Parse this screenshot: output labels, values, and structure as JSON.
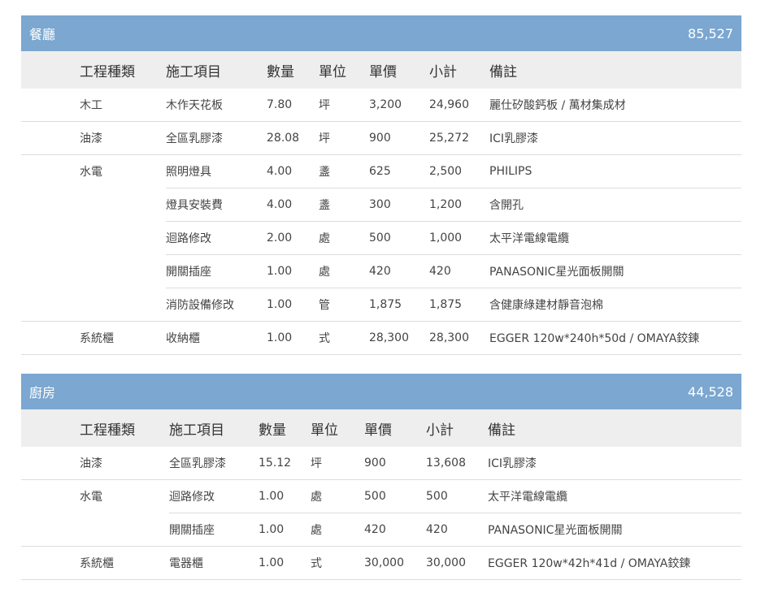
{
  "sections": [
    {
      "name": "餐廳",
      "total": "85,527",
      "headers": [
        "工程種類",
        "施工項目",
        "數量",
        "單位",
        "單價",
        "小計",
        "備註"
      ],
      "rows": [
        {
          "cat": "木工",
          "item": "木作天花板",
          "qty": "7.80",
          "unit": "坪",
          "price": "3,200",
          "subtotal": "24,960",
          "note": "麗仕矽酸鈣板 / 萬材集成材"
        },
        {
          "cat": "油漆",
          "item": "全區乳膠漆",
          "qty": "28.08",
          "unit": "坪",
          "price": "900",
          "subtotal": "25,272",
          "note": "ICI乳膠漆"
        },
        {
          "cat": "水電",
          "item": "照明燈具",
          "qty": "4.00",
          "unit": "盞",
          "price": "625",
          "subtotal": "2,500",
          "note": "PHILIPS"
        },
        {
          "cat": "",
          "item": "燈具安裝費",
          "qty": "4.00",
          "unit": "盞",
          "price": "300",
          "subtotal": "1,200",
          "note": "含開孔"
        },
        {
          "cat": "",
          "item": "迴路修改",
          "qty": "2.00",
          "unit": "處",
          "price": "500",
          "subtotal": "1,000",
          "note": "太平洋電線電纜"
        },
        {
          "cat": "",
          "item": "開關插座",
          "qty": "1.00",
          "unit": "處",
          "price": "420",
          "subtotal": "420",
          "note": "PANASONIC星光面板開關"
        },
        {
          "cat": "",
          "item": "消防設備修改",
          "qty": "1.00",
          "unit": "管",
          "price": "1,875",
          "subtotal": "1,875",
          "note": "含健康綠建材靜音泡棉"
        },
        {
          "cat": "系統櫃",
          "item": "收納櫃",
          "qty": "1.00",
          "unit": "式",
          "price": "28,300",
          "subtotal": "28,300",
          "note": "EGGER 120w*240h*50d / OMAYA鉸鍊"
        }
      ]
    },
    {
      "name": "廚房",
      "total": "44,528",
      "headers": [
        "工程種類",
        "施工項目",
        "數量",
        "單位",
        "單價",
        "小計",
        "備註"
      ],
      "rows": [
        {
          "cat": "油漆",
          "item": "全區乳膠漆",
          "qty": "15.12",
          "unit": "坪",
          "price": "900",
          "subtotal": "13,608",
          "note": "ICI乳膠漆"
        },
        {
          "cat": "水電",
          "item": "迴路修改",
          "qty": "1.00",
          "unit": "處",
          "price": "500",
          "subtotal": "500",
          "note": "太平洋電線電纜"
        },
        {
          "cat": "",
          "item": "開關插座",
          "qty": "1.00",
          "unit": "處",
          "price": "420",
          "subtotal": "420",
          "note": "PANASONIC星光面板開關"
        },
        {
          "cat": "系統櫃",
          "item": "電器櫃",
          "qty": "1.00",
          "unit": "式",
          "price": "30,000",
          "subtotal": "30,000",
          "note": "EGGER 120w*42h*41d / OMAYA鉸鍊"
        }
      ]
    }
  ]
}
